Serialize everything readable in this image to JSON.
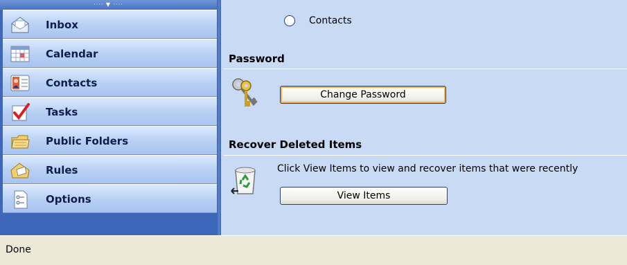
{
  "nav": {
    "grip": "···· ▼ ····",
    "items": [
      {
        "label": "Inbox",
        "icon": "inbox-icon"
      },
      {
        "label": "Calendar",
        "icon": "calendar-icon"
      },
      {
        "label": "Contacts",
        "icon": "contacts-icon"
      },
      {
        "label": "Tasks",
        "icon": "tasks-icon"
      },
      {
        "label": "Public Folders",
        "icon": "public-folders-icon"
      },
      {
        "label": "Rules",
        "icon": "rules-icon"
      },
      {
        "label": "Options",
        "icon": "options-icon"
      }
    ]
  },
  "content": {
    "radio_contacts_label": "Contacts",
    "password_title": "Password",
    "change_password_label": "Change Password",
    "recover_title": "Recover Deleted Items",
    "recover_text": "Click View Items to view and recover items that were recently",
    "view_items_label": "View Items"
  },
  "status": {
    "text": "Done"
  },
  "colors": {
    "nav_bg": "#3e67b9",
    "content_bg": "#c8daf4",
    "button_focus": "#f0b045",
    "statusbar": "#ece9d8"
  }
}
